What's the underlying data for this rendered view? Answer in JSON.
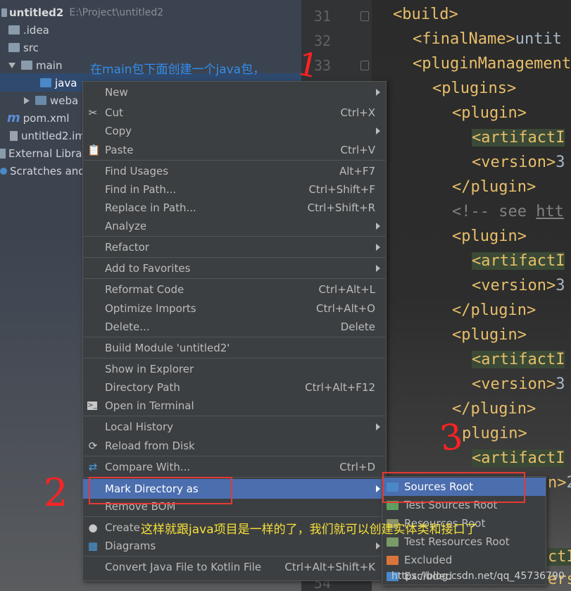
{
  "project_tree": {
    "root_label": "untitled2",
    "root_path": "E:\\Project\\untitled2",
    "items": [
      {
        "label": ".idea"
      },
      {
        "label": "src"
      },
      {
        "label": "main"
      },
      {
        "label": "java"
      },
      {
        "label": "weba"
      },
      {
        "label": "pom.xml"
      },
      {
        "label": "untitled2.im"
      },
      {
        "label": "External Librar"
      },
      {
        "label": "Scratches and"
      }
    ]
  },
  "annotations": {
    "step1_text": "在main包下面创建一个java包，",
    "step1_mark": "1",
    "step2_mark": "2",
    "step3_mark": "3",
    "note_text": "这样就跟java项目是一样的了，我们就可以创建实体类和接口了"
  },
  "editor": {
    "line_numbers": [
      "31",
      "32",
      "33",
      "54"
    ],
    "lines": [
      {
        "tag": "<build>"
      },
      {
        "tag": "<finalName>",
        "value": "untit"
      },
      {
        "tag": "<pluginManagement"
      },
      {
        "tag": "<plugins>"
      },
      {
        "tag": "<plugin>"
      },
      {
        "tag": "<artifactI"
      },
      {
        "tag": "<version>",
        "value": "3"
      },
      {
        "tag": "</plugin>"
      },
      {
        "comment": "<!-- see ",
        "link": "htt"
      },
      {
        "tag": "<plugin>"
      },
      {
        "tag": "<artifactI"
      },
      {
        "tag": "<version>",
        "value": "3"
      },
      {
        "tag": "</plugin>"
      },
      {
        "tag": "<plugin>"
      },
      {
        "tag": "<artifactI"
      },
      {
        "tag": "<version>",
        "value": "3"
      },
      {
        "tag": "</plugin>"
      },
      {
        "tag": "plugin>"
      },
      {
        "tag": "<artifactI"
      },
      {
        "tag": "n>",
        "value": "2"
      },
      {
        "tag": "ctI"
      },
      {
        "tag": "ersion>",
        "value": "3"
      }
    ]
  },
  "context_menu": {
    "items": [
      {
        "label": "New",
        "shortcut": "",
        "icon": ""
      },
      {
        "label": "Cut",
        "shortcut": "Ctrl+X",
        "icon": "scissors-icon"
      },
      {
        "label": "Copy",
        "shortcut": "",
        "icon": ""
      },
      {
        "label": "Paste",
        "shortcut": "Ctrl+V",
        "icon": "clipboard-icon"
      },
      {
        "label": "Find Usages",
        "shortcut": "Alt+F7",
        "icon": ""
      },
      {
        "label": "Find in Path...",
        "shortcut": "Ctrl+Shift+F",
        "icon": ""
      },
      {
        "label": "Replace in Path...",
        "shortcut": "Ctrl+Shift+R",
        "icon": ""
      },
      {
        "label": "Analyze",
        "shortcut": "",
        "icon": ""
      },
      {
        "label": "Refactor",
        "shortcut": "",
        "icon": ""
      },
      {
        "label": "Add to Favorites",
        "shortcut": "",
        "icon": ""
      },
      {
        "label": "Reformat Code",
        "shortcut": "Ctrl+Alt+L",
        "icon": ""
      },
      {
        "label": "Optimize Imports",
        "shortcut": "Ctrl+Alt+O",
        "icon": ""
      },
      {
        "label": "Delete...",
        "shortcut": "Delete",
        "icon": ""
      },
      {
        "label": "Build Module 'untitled2'",
        "shortcut": "",
        "icon": ""
      },
      {
        "label": "Show in Explorer",
        "shortcut": "",
        "icon": ""
      },
      {
        "label": "Directory Path",
        "shortcut": "Ctrl+Alt+F12",
        "icon": ""
      },
      {
        "label": "Open in Terminal",
        "shortcut": "",
        "icon": "terminal-icon"
      },
      {
        "label": "Local History",
        "shortcut": "",
        "icon": ""
      },
      {
        "label": "Reload from Disk",
        "shortcut": "",
        "icon": "reload-icon"
      },
      {
        "label": "Compare With...",
        "shortcut": "Ctrl+D",
        "icon": "compare-icon"
      },
      {
        "label": "Mark Directory as",
        "shortcut": "",
        "icon": ""
      },
      {
        "label": "Remove BOM",
        "shortcut": "",
        "icon": ""
      },
      {
        "label": "Create",
        "shortcut": "",
        "icon": "github-icon"
      },
      {
        "label": "Diagrams",
        "shortcut": "",
        "icon": "diagram-icon"
      },
      {
        "label": "Convert Java File to Kotlin File",
        "shortcut": "Ctrl+Alt+Shift+K",
        "icon": ""
      }
    ]
  },
  "mark_submenu": {
    "items": [
      {
        "label": "Sources Root",
        "color": "#4a88c7"
      },
      {
        "label": "Test Sources Root",
        "color": "#5f9e5f"
      },
      {
        "label": "Resources Root",
        "color": "#8a8f6a"
      },
      {
        "label": "Test Resources Root",
        "color": "#7a9a6a"
      },
      {
        "label": "Excluded",
        "color": "#d9743a"
      },
      {
        "label": "Excluded",
        "color": "#4a88c7"
      }
    ]
  },
  "watermark": "https://blog.csdn.net/qq_45736790"
}
